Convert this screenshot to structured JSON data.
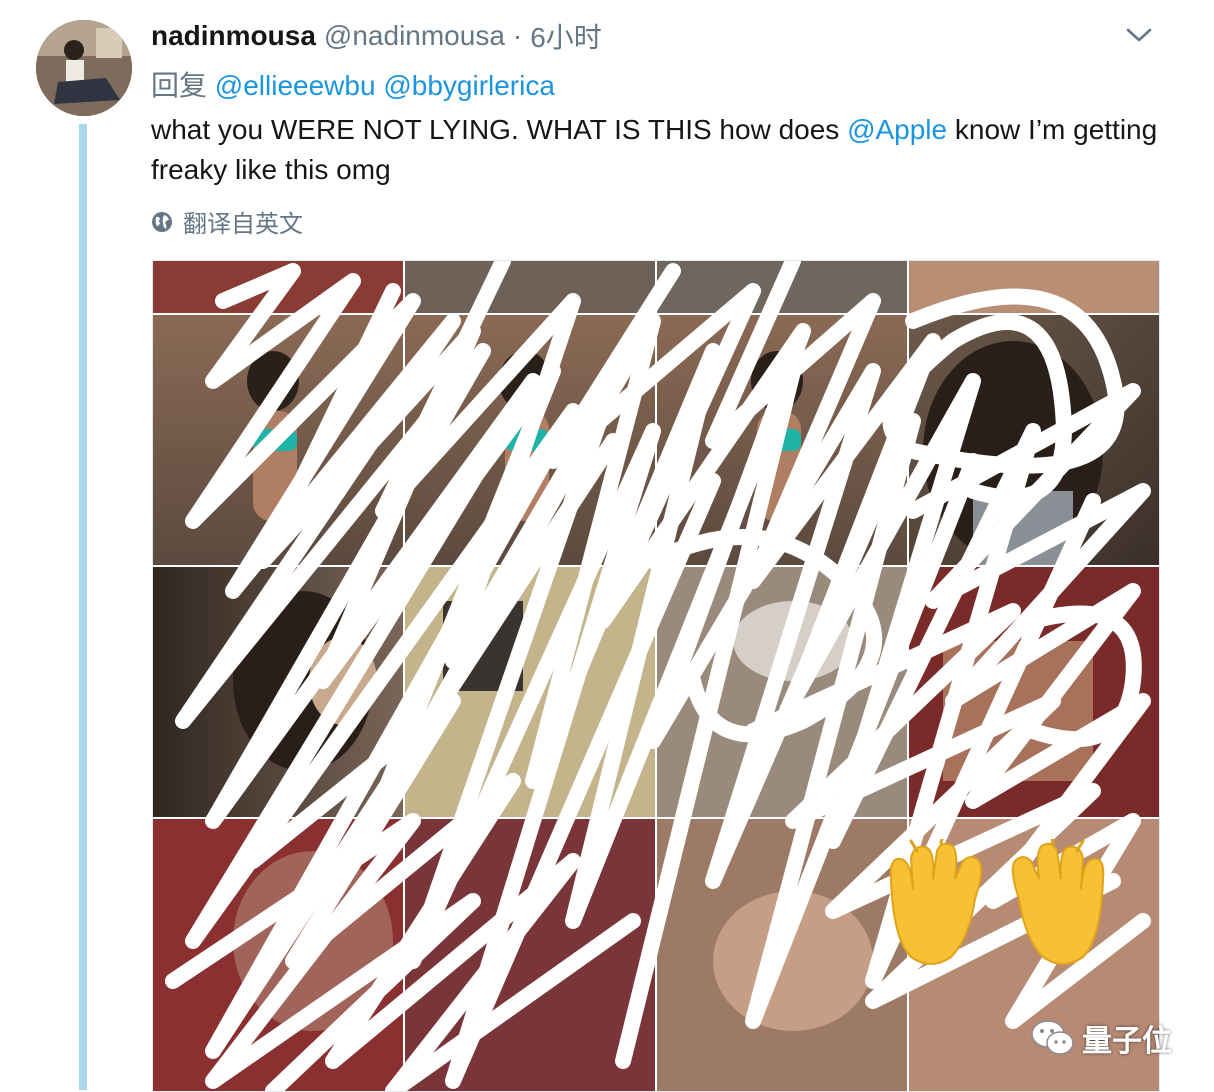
{
  "tweet": {
    "display_name": "nadinmousa",
    "handle": "@nadinmousa",
    "separator": "·",
    "timestamp": "6小时",
    "reply_prefix": "回复",
    "reply_to": [
      "@ellieeewbu",
      "@bbygirlerica"
    ],
    "text_before": "what you WERE NOT LYING. WHAT IS THIS how does ",
    "text_mention": "@Apple",
    "text_after": " know I’m getting freaky like this omg",
    "translate_label": "翻译自英文"
  },
  "icons": {
    "menu": "chevron-down-icon",
    "translate": "globe-icon",
    "emoji": "raised-hands-emoji",
    "watermark": "wechat-icon"
  },
  "watermark": {
    "text": "量子位"
  },
  "colors": {
    "link": "#1b95e0",
    "secondary": "#657786",
    "thread_line": "#a8d8ea",
    "scribble": "#ffffff"
  }
}
